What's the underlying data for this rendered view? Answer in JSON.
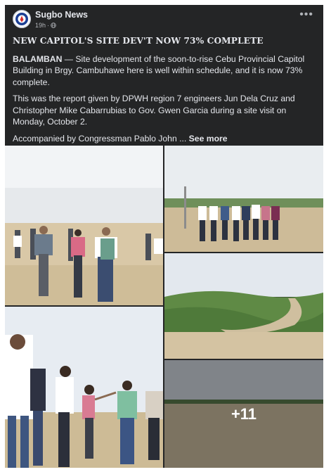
{
  "post": {
    "page_name": "Sugbo News",
    "time": "19h",
    "audience_icon": "globe-icon",
    "headline": "NEW CAPITOL'S SITE DEV'T NOW 73% COMPLETE",
    "dateline": "BALAMBAN",
    "paragraph1_rest": " — Site development of the soon-to-rise Cebu Provincial Capitol Building in Brgy. Cambuhawe here is well within schedule, and it is now 73% complete.",
    "paragraph2": "This was the report given by DPWH region 7 engineers Jun Dela Cruz and Christopher Mike Cabarrubias to Gov. Gwen Garcia during a site visit on Monday, October 2.",
    "paragraph3": "Accompanied by Congressman Pablo John ...",
    "see_more": "See more",
    "more_photos": "+11"
  },
  "colors": {
    "card_bg": "#242526",
    "text_primary": "#e4e6eb",
    "text_secondary": "#b0b3b8"
  },
  "photos": [
    {
      "scene": "officials-walking-site"
    },
    {
      "scene": "group-lined-up-site"
    },
    {
      "scene": "road-through-hills"
    },
    {
      "scene": "group-pointing-site"
    },
    {
      "scene": "wide-cleared-ground"
    }
  ]
}
